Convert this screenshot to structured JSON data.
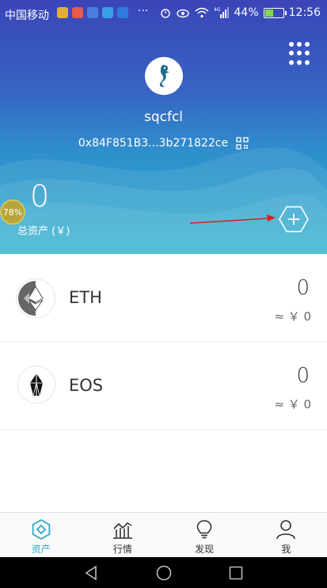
{
  "status_bar": {
    "carrier": "中国移动",
    "overflow": "···",
    "battery_percent": "44%",
    "battery_level": 0.44,
    "time": "12:56",
    "network": "4G"
  },
  "header": {
    "username": "sqcfcl",
    "address": "0x84F851B3...3b271822ce",
    "total_value": "0",
    "total_label": "总资产 (￥)",
    "badge_text": "78%"
  },
  "tokens": [
    {
      "symbol": "ETH",
      "amount": "0",
      "fiat": "≈ ￥ 0",
      "icon": "ethereum-icon"
    },
    {
      "symbol": "EOS",
      "amount": "0",
      "fiat": "≈ ￥ 0",
      "icon": "eos-icon"
    }
  ],
  "bottom_nav": {
    "assets": "资产",
    "market": "行情",
    "discover": "发现",
    "me": "我"
  },
  "colors": {
    "accent": "#2fa9c6",
    "header_top": "#3a45b8",
    "header_bottom": "#2bb1cd",
    "annotation_arrow": "#d42020"
  }
}
